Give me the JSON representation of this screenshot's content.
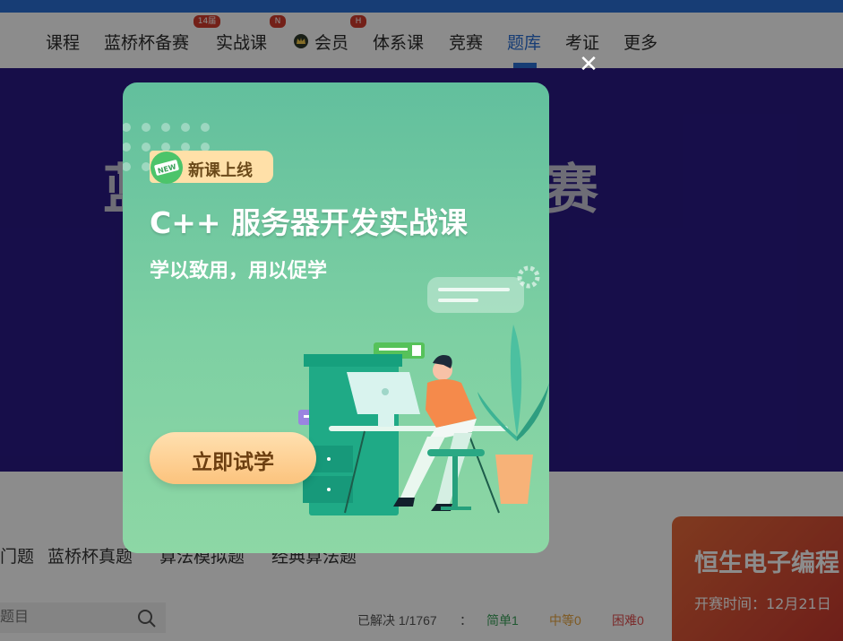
{
  "nav": {
    "items": [
      {
        "label": "课程"
      },
      {
        "label": "蓝桥杯备赛"
      },
      {
        "label": "实战课"
      },
      {
        "label": "会员"
      },
      {
        "label": "体系课"
      },
      {
        "label": "竞赛"
      },
      {
        "label": "题库",
        "active": true
      },
      {
        "label": "考证"
      },
      {
        "label": "更多"
      }
    ],
    "badges": {
      "bluebridge": "14届",
      "practice": "N",
      "member": "H"
    }
  },
  "hero": {
    "title_left": "蓝",
    "title_right": "赛"
  },
  "tabs": [
    {
      "label": "门题"
    },
    {
      "label": "蓝桥杯真题"
    },
    {
      "label": "算法模拟题"
    },
    {
      "label": "经典算法题"
    }
  ],
  "search": {
    "placeholder": "题目"
  },
  "stats": {
    "solved": "已解决 1/1767",
    "separator": "：",
    "easy": "简单1",
    "medium": "中等0",
    "hard": "困难0"
  },
  "side_card": {
    "title": "恒生电子编程",
    "time": "开赛时间：12月21日"
  },
  "modal": {
    "tag": "新课上线",
    "new_badge": "NEW",
    "title": "C++ 服务器开发实战课",
    "subtitle": "学以致用，用以促学",
    "cta": "立即试学",
    "close": "✕"
  },
  "colors": {
    "brand_blue": "#2b6fd6",
    "modal_green": "#62bf9d",
    "cta_orange": "#fcc37d",
    "easy_green": "#3aa05a",
    "medium_orange": "#e6a23c",
    "hard_red": "#e05050"
  }
}
